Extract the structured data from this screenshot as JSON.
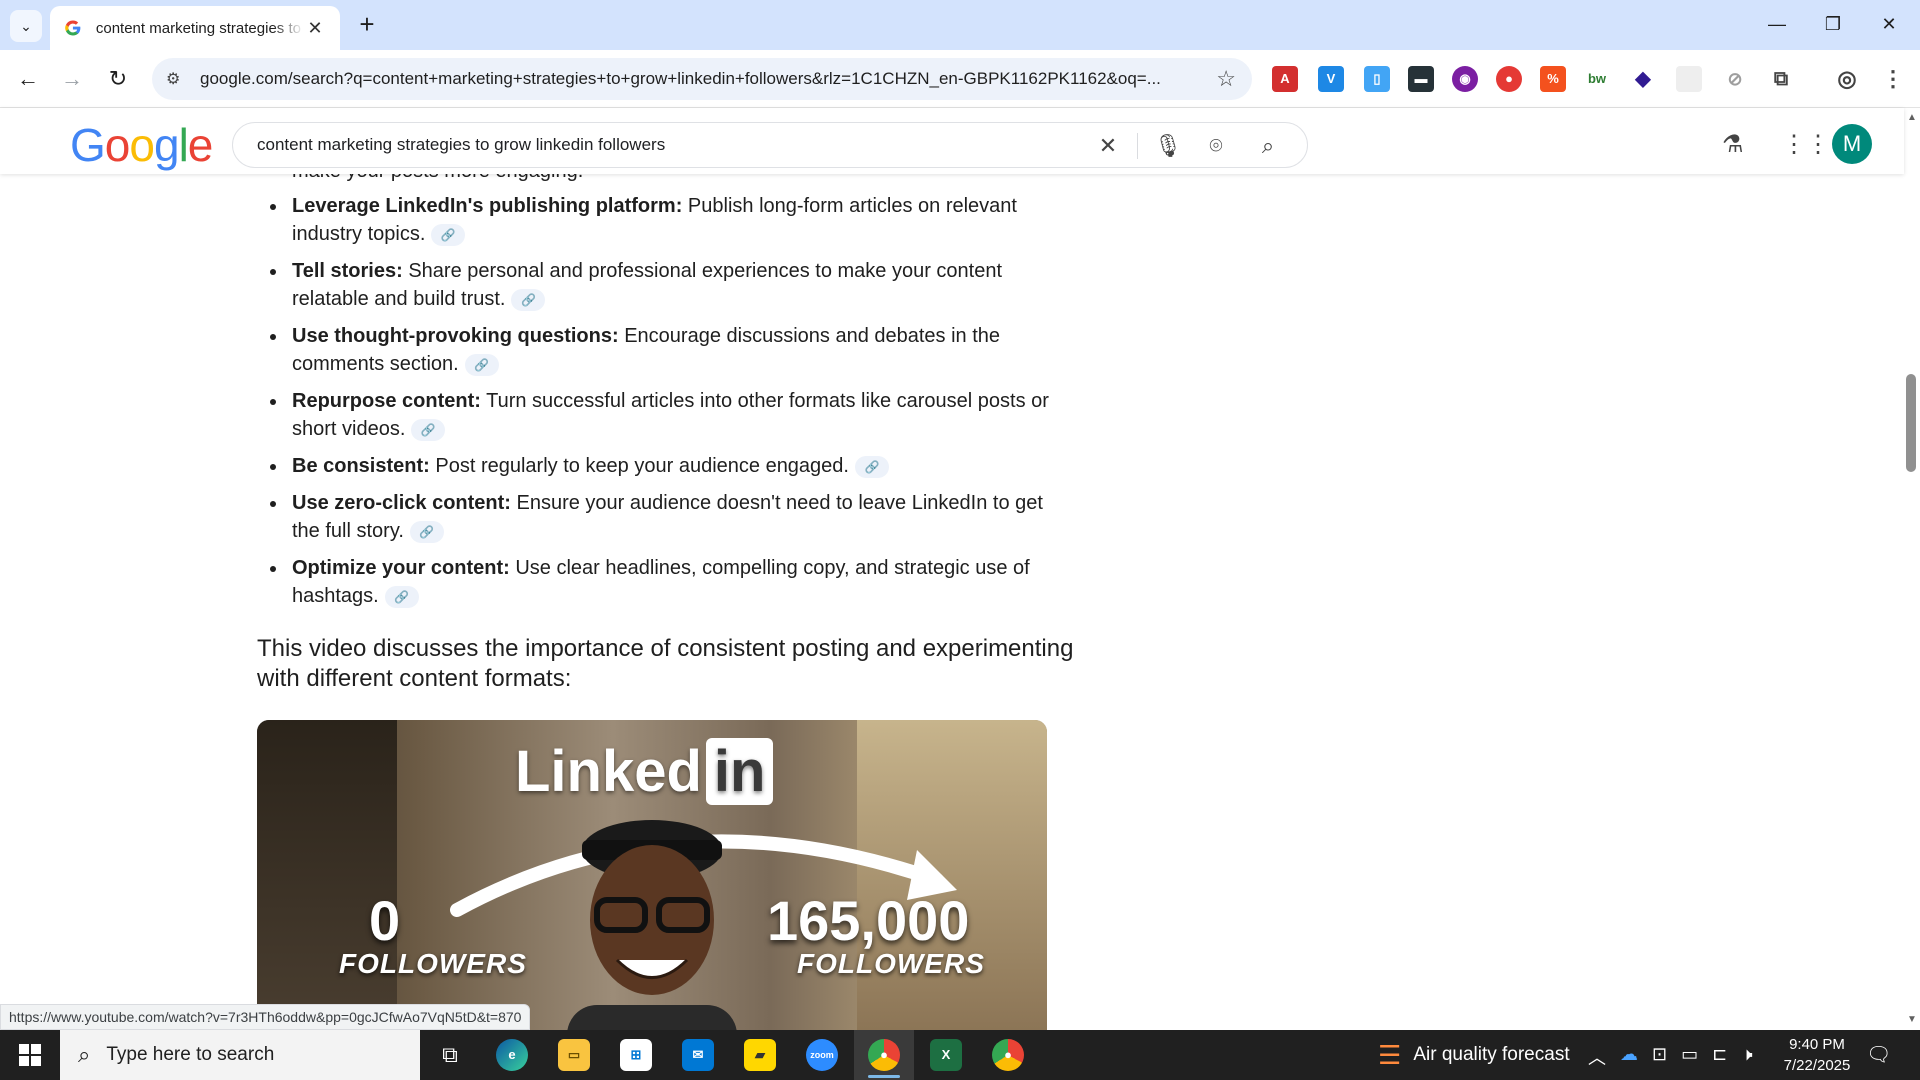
{
  "browser": {
    "tab_title": "content marketing strategies to grow linkedin followers",
    "url": "google.com/search?q=content+marketing+strategies+to+grow+linkedin+followers&rlz=1C1CHZN_en-GBPK1162PK1162&oq=...",
    "status_url": "https://www.youtube.com/watch?v=7r3HTh6oddw&pp=0gcJCfwAo7VqN5tD&t=870"
  },
  "google": {
    "logo": "Google",
    "query": "content marketing strategies to grow linkedin followers",
    "avatar_letter": "M"
  },
  "results": {
    "clipped_line": "make your posts more engaging.",
    "bullets": [
      {
        "title": "Leverage LinkedIn's publishing platform:",
        "text": " Publish long-form articles on relevant industry topics."
      },
      {
        "title": "Tell stories:",
        "text": " Share personal and professional experiences to make your content relatable and build trust."
      },
      {
        "title": "Use thought-provoking questions:",
        "text": " Encourage discussions and debates in the comments section."
      },
      {
        "title": "Repurpose content:",
        "text": " Turn successful articles into other formats like carousel posts or short videos."
      },
      {
        "title": "Be consistent:",
        "text": " Post regularly to keep your audience engaged."
      },
      {
        "title": "Use zero-click content:",
        "text": " Ensure your audience doesn't need to leave LinkedIn to get the full story."
      },
      {
        "title": "Optimize your content:",
        "text": " Use clear headlines, compelling copy, and strategic use of hashtags."
      }
    ],
    "video_heading": "This video discusses the importance of consistent posting and experimenting with different content formats:",
    "thumbnail": {
      "brand_text": "Linked",
      "brand_in": "in",
      "left_count": "0",
      "left_label": "FOLLOWERS",
      "right_count": "165,000",
      "right_label": "FOLLOWERS"
    }
  },
  "taskbar": {
    "search_placeholder": "Type here to search",
    "weather": "Air quality forecast",
    "time": "9:40 PM",
    "date": "7/22/2025"
  },
  "colors": {
    "accent_blue": "#1a73e8",
    "tabbar": "#d3e3fd",
    "avatar": "#00897b"
  }
}
